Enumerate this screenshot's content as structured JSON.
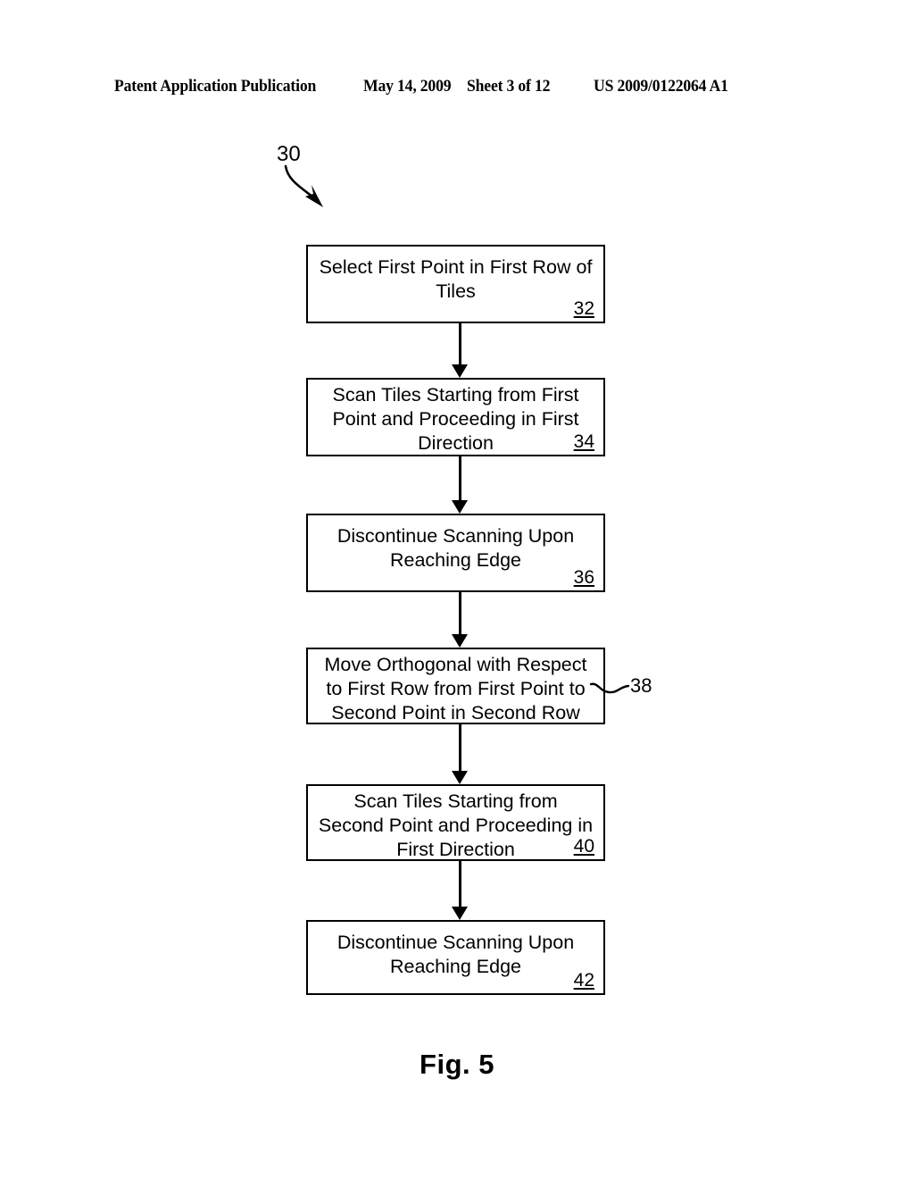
{
  "header": {
    "publication": "Patent Application Publication",
    "date": "May 14, 2009",
    "sheet": "Sheet 3 of 12",
    "patent_number": "US 2009/0122064 A1"
  },
  "figure": {
    "caption": "Fig. 5",
    "diagram_ref": "30",
    "external_ref_38": "38"
  },
  "flowchart": {
    "type": "flowchart",
    "orientation": "vertical",
    "nodes": [
      {
        "ref": "32",
        "text": "Select First Point in First Row of\nTiles",
        "ref_position": "inside-bottom-right"
      },
      {
        "ref": "34",
        "text": "Scan Tiles Starting from First\nPoint and Proceeding in First\nDirection",
        "ref_position": "inside-bottom-right"
      },
      {
        "ref": "36",
        "text": "Discontinue Scanning Upon\nReaching Edge",
        "ref_position": "inside-bottom-right"
      },
      {
        "ref": "38",
        "text": "Move Orthogonal with Respect\nto First Row from First Point to\nSecond Point in Second Row",
        "ref_position": "outside-right"
      },
      {
        "ref": "40",
        "text": "Scan Tiles Starting from\nSecond Point and Proceeding in\nFirst Direction",
        "ref_position": "inside-bottom-right"
      },
      {
        "ref": "42",
        "text": "Discontinue Scanning Upon\nReaching Edge",
        "ref_position": "inside-bottom-right"
      }
    ],
    "edges": [
      {
        "from": "32",
        "to": "34"
      },
      {
        "from": "34",
        "to": "36"
      },
      {
        "from": "36",
        "to": "38"
      },
      {
        "from": "38",
        "to": "40"
      },
      {
        "from": "40",
        "to": "42"
      }
    ]
  },
  "colors": {
    "ink": "#000000",
    "paper": "#ffffff"
  }
}
